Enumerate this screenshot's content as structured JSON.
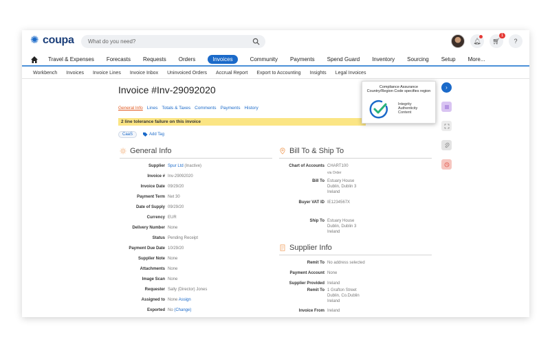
{
  "header": {
    "logo_text": "coupa",
    "search_placeholder": "What do you need?",
    "cart_count": "1",
    "help_label": "?"
  },
  "main_nav": {
    "items": [
      "Travel & Expenses",
      "Forecasts",
      "Requests",
      "Orders",
      "Invoices",
      "Community",
      "Payments",
      "Spend Guard",
      "Inventory",
      "Sourcing",
      "Setup",
      "More..."
    ],
    "active": "Invoices"
  },
  "sub_nav": {
    "items": [
      "Workbench",
      "Invoices",
      "Invoice Lines",
      "Invoice Inbox",
      "Uninvoiced Orders",
      "Accrual Report",
      "Export to Accounting",
      "Insights",
      "Legal Invoices"
    ]
  },
  "invoice": {
    "title": "Invoice #Inv-29092020",
    "tabs": [
      "General Info",
      "Lines",
      "Totals & Taxes",
      "Comments",
      "Payments",
      "History"
    ],
    "warning": "2 line tolerance failure on this invoice",
    "tag_pill": "CaaS",
    "add_tag": "Add Tag"
  },
  "general_info": {
    "title": "General Info",
    "fields": [
      {
        "label": "Supplier",
        "value": "Spur Ltd",
        "suffix": " (Inactive)"
      },
      {
        "label": "Invoice #",
        "value": "Inv-29092020"
      },
      {
        "label": "Invoice Date",
        "value": "09/29/20"
      },
      {
        "label": "Payment Term",
        "value": "Net 30"
      },
      {
        "label": "Date of Supply",
        "value": "09/29/20"
      },
      {
        "label": "Currency",
        "value": "EUR"
      },
      {
        "label": "Delivery Number",
        "value": "None"
      },
      {
        "label": "Status",
        "value": "Pending Receipt"
      },
      {
        "label": "Payment Due Date",
        "value": "10/29/20"
      },
      {
        "label": "Supplier Note",
        "value": "None"
      },
      {
        "label": "Attachments",
        "value": "None"
      },
      {
        "label": "Image Scan",
        "value": "None"
      },
      {
        "label": "Requester",
        "value": "Sally (Director) Jones"
      },
      {
        "label": "Assigned to",
        "value": "None",
        "link": "Assign"
      },
      {
        "label": "Exported",
        "value": "No",
        "link": "(Change)"
      }
    ]
  },
  "bill_ship": {
    "title": "Bill To & Ship To",
    "chart_label": "Chart of Accounts",
    "chart_value": "CHART100",
    "chart_sub": "via Order",
    "bill_label": "Bill To",
    "bill_value": "Estuary House\nDublin, Dublin 3\nIreland",
    "vat_label": "Buyer VAT ID",
    "vat_value": "IE1234567X",
    "ship_label": "Ship To",
    "ship_value": "Estuary House\nDublin, Dublin 3\nIreland"
  },
  "supplier_info": {
    "title": "Supplier Info",
    "remit_label": "Remit To",
    "remit_value": "No address selected",
    "payacct_label": "Payment Account",
    "payacct_value": "None",
    "provided_label": "Supplier Provided",
    "provided_value": "Ireland",
    "remit2_label": "Remit To",
    "remit2_value": "1 Grafton Street\nDublin, Co.Dublin\nIreland",
    "from_label": "Invoice From",
    "from_value": "Ireland"
  },
  "compliance": {
    "title_line1": "Compliance Assurance",
    "title_line2": "Country/Region Code specifies region",
    "items": [
      "Integrity",
      "Authenticity",
      "Content"
    ]
  },
  "colors": {
    "brand": "#1b6ac9",
    "warning": "#fbe584",
    "check": "#27b37a"
  }
}
